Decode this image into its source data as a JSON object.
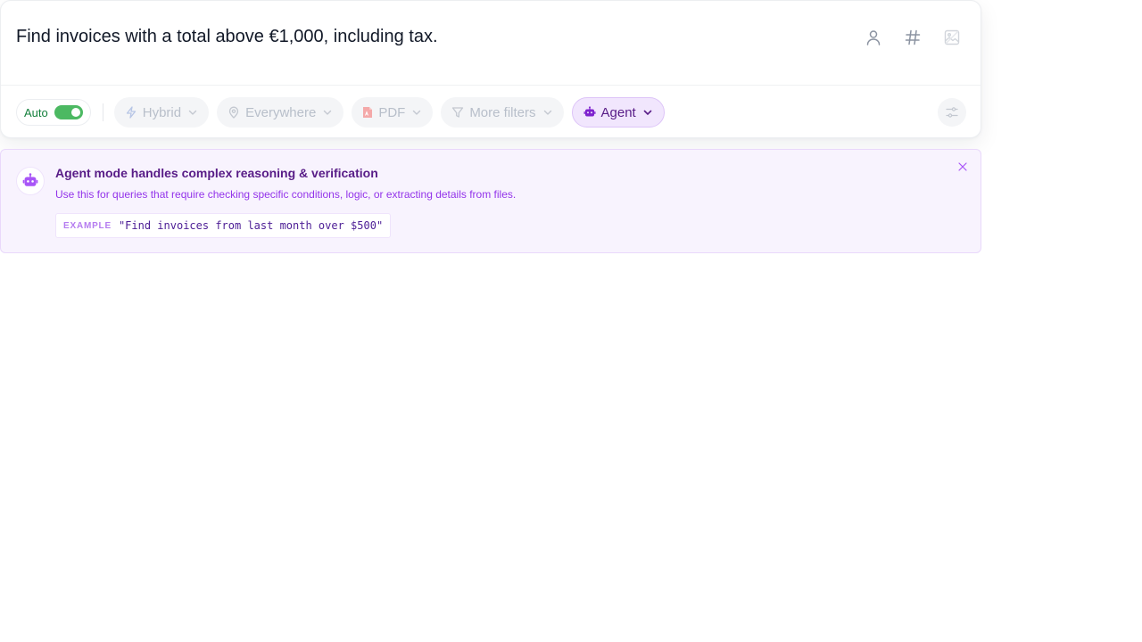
{
  "search": {
    "query": "Find invoices with a total above €1,000, including tax.",
    "actions": [
      {
        "icon": "person-icon",
        "label": "Filter by person"
      },
      {
        "icon": "hashtag-icon",
        "label": "Filter by tag"
      },
      {
        "icon": "image-icon",
        "label": "Search by image"
      }
    ]
  },
  "filters": {
    "auto": {
      "label": "Auto",
      "enabled": true
    },
    "mode": {
      "label": "Hybrid",
      "icon": "lightning-icon"
    },
    "location": {
      "label": "Everywhere",
      "icon": "map-pin-icon"
    },
    "file_type": {
      "label": "PDF",
      "icon": "pdf-file-icon"
    },
    "more": {
      "label": "More filters",
      "icon": "funnel-icon"
    },
    "agent": {
      "label": "Agent",
      "icon": "robot-icon",
      "active": true
    },
    "settings_icon": "sliders-icon"
  },
  "agent_banner": {
    "title": "Agent mode handles complex reasoning & verification",
    "description": "Use this for queries that require checking specific conditions, logic, or extracting details from files.",
    "example_tag": "EXAMPLE",
    "example_text": "\"Find invoices from last month over $500\"",
    "icon": "robot-icon",
    "close_icon": "close-icon"
  },
  "colors": {
    "accent_purple": "#9333ea",
    "banner_bg": "#f8f3fe",
    "toggle_green": "#4cb962"
  }
}
